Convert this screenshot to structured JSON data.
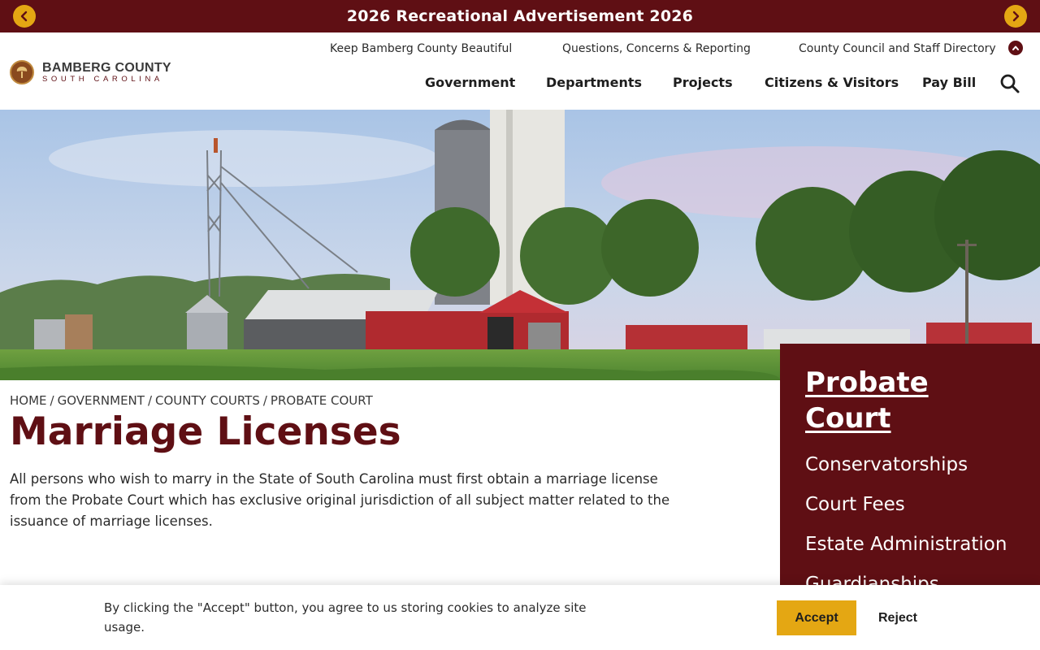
{
  "alert": {
    "title": "2026 Recreational Advertisement 2026",
    "prev_icon": "chevron-left-icon",
    "next_icon": "chevron-right-icon"
  },
  "logo": {
    "name": "BAMBERG COUNTY",
    "subtitle": "SOUTH CAROLINA"
  },
  "utility_nav": [
    {
      "label": "Keep Bamberg County Beautiful"
    },
    {
      "label": "Questions, Concerns & Reporting"
    },
    {
      "label": "County Council and Staff Directory"
    }
  ],
  "main_nav": [
    {
      "label": "Government"
    },
    {
      "label": "Departments"
    },
    {
      "label": "Projects"
    },
    {
      "label": "Citizens & Visitors"
    },
    {
      "label": "Pay Bill"
    }
  ],
  "breadcrumb": [
    "HOME",
    "GOVERNMENT",
    "COUNTY COURTS",
    "PROBATE COURT"
  ],
  "page": {
    "title": "Marriage Licenses",
    "intro": "All persons who wish to marry in the State of South Carolina must first obtain a marriage license from the Probate Court which has exclusive original jurisdiction of all subject matter related to the issuance of marriage licenses."
  },
  "sidebar": {
    "heading": "Probate Court",
    "items": [
      {
        "label": "Conservatorships"
      },
      {
        "label": "Court Fees"
      },
      {
        "label": "Estate Administration"
      },
      {
        "label": "Guardianships"
      }
    ]
  },
  "cookie": {
    "text": "By clicking the \"Accept\" button, you agree to us storing cookies to analyze site usage.",
    "accept_label": "Accept",
    "reject_label": "Reject"
  },
  "colors": {
    "maroon": "#5f0f14",
    "gold": "#e4a713"
  }
}
